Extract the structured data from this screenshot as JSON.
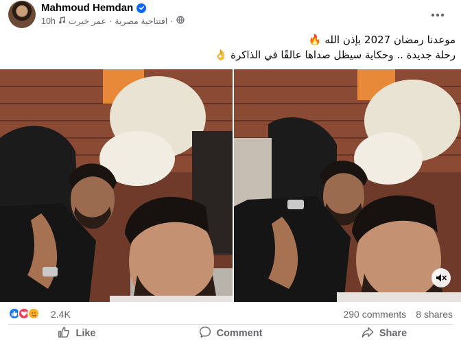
{
  "post": {
    "author": "Mahmoud Hemdan",
    "verified": true,
    "time": "10h",
    "music": "عمر خيرت",
    "track": "افتتاحية مصرية",
    "separator": "·",
    "privacy_icon": "globe-icon",
    "caption_line1": "موعدنا رمضان 2027 بإذن الله",
    "caption_line2": "رحلة جديدة .. وحكاية سيظل صداها عالقًا في الذاكرة",
    "emoji_fire": "🔥",
    "emoji_hand": "👌"
  },
  "stats": {
    "reaction_count": "2.4K",
    "comments": "290 comments",
    "shares": "8 shares"
  },
  "actions": {
    "like": "Like",
    "comment": "Comment",
    "share": "Share"
  },
  "icons": [
    "verified-badge-icon",
    "music-note-icon",
    "globe-icon",
    "more-options-icon",
    "mute-icon",
    "like-icon",
    "comment-icon",
    "share-icon"
  ],
  "colors": {
    "accent": "#0866ff",
    "like_blue": "#1877f2",
    "love_red": "#f33e58",
    "care_yellow": "#f7b125",
    "secondary_text": "#65676b"
  }
}
